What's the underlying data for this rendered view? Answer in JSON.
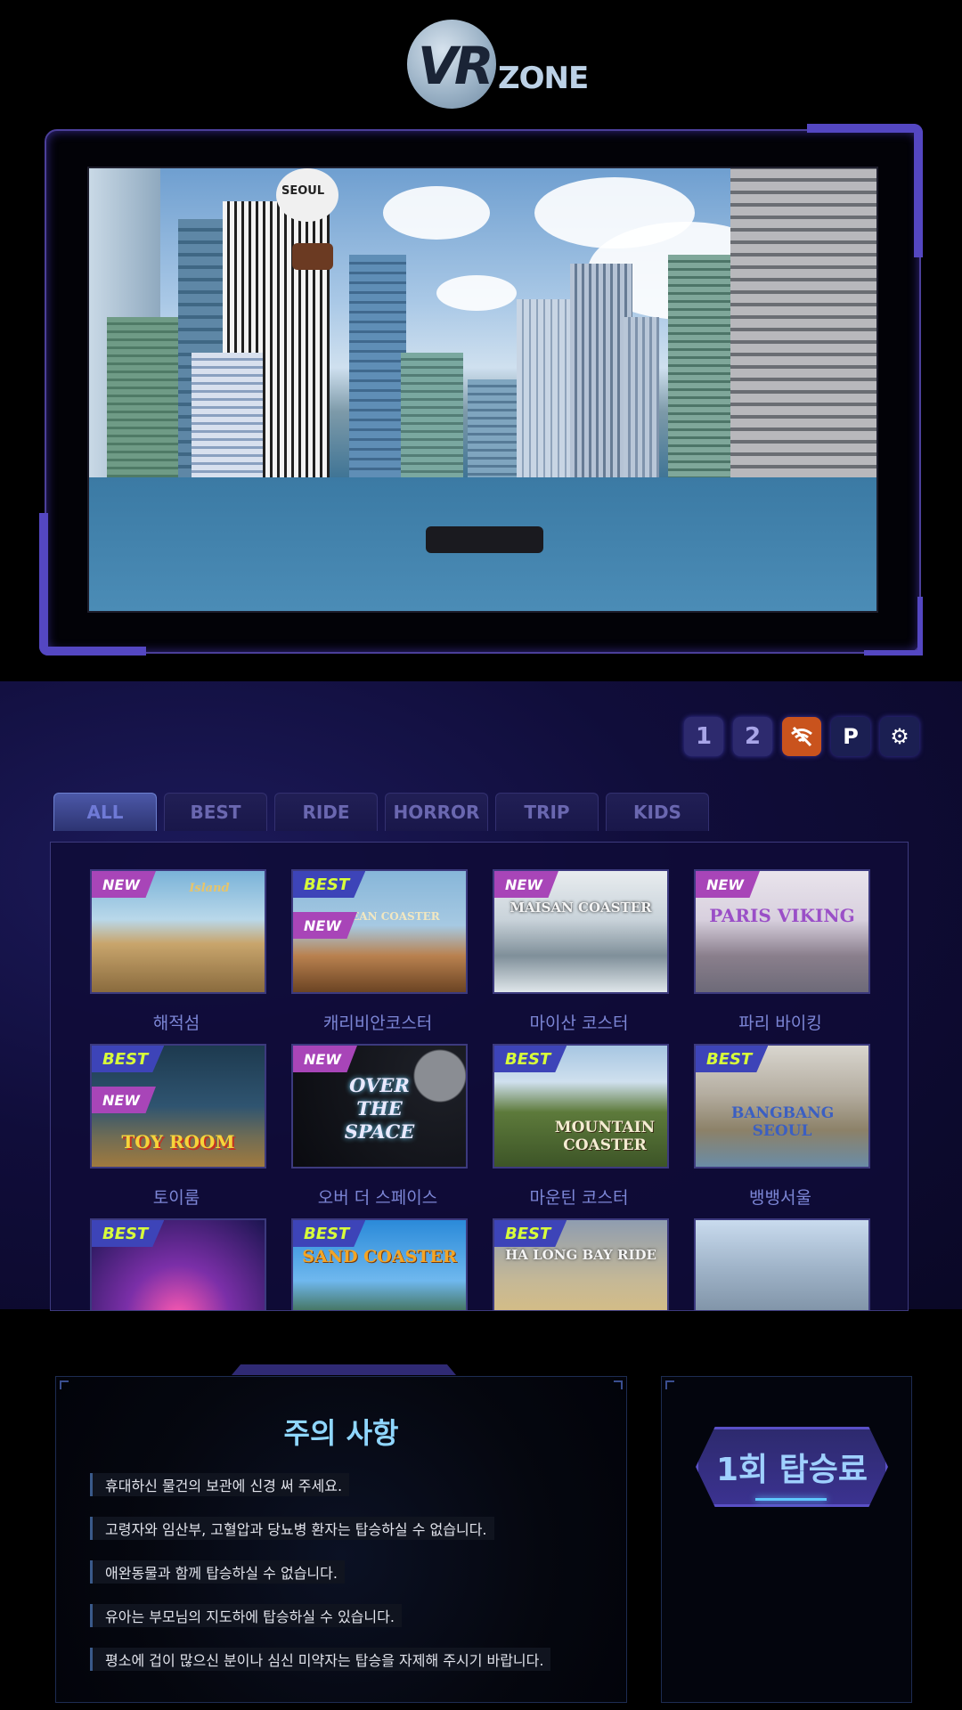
{
  "logo": {
    "vr": "VR",
    "zone": "ZONE"
  },
  "scene": {
    "balloon_text": "SEOUL"
  },
  "toolbar": {
    "btn1": "1",
    "btn2": "2",
    "btn_wifi": "wifi-off",
    "btn_p": "P",
    "btn_gear": "⚙"
  },
  "tabs": [
    {
      "label": "ALL",
      "active": true
    },
    {
      "label": "BEST",
      "active": false
    },
    {
      "label": "RIDE",
      "active": false
    },
    {
      "label": "HORROR",
      "active": false
    },
    {
      "label": "TRIP",
      "active": false
    },
    {
      "label": "KIDS",
      "active": false
    }
  ],
  "cards": [
    {
      "label": "해적섬",
      "badges": [
        "NEW"
      ],
      "thumb_title": "Island"
    },
    {
      "label": "캐리비안코스터",
      "badges": [
        "BEST",
        "NEW"
      ],
      "thumb_title": "RIBBEAN COASTER"
    },
    {
      "label": "마이산 코스터",
      "badges": [
        "NEW"
      ],
      "thumb_title": "MAISAN COASTER"
    },
    {
      "label": "파리 바이킹",
      "badges": [
        "NEW"
      ],
      "thumb_title": "PARIS VIKING"
    },
    {
      "label": "토이룸",
      "badges": [
        "BEST",
        "NEW"
      ],
      "thumb_title": "TOY ROOM"
    },
    {
      "label": "오버 더 스페이스",
      "badges": [
        "NEW"
      ],
      "thumb_title": "OVER THE SPACE"
    },
    {
      "label": "마운틴 코스터",
      "badges": [
        "BEST"
      ],
      "thumb_title": "MOUNTAIN COASTER"
    },
    {
      "label": "뱅뱅서울",
      "badges": [
        "BEST"
      ],
      "thumb_title": "BANGBANG SEOUL"
    },
    {
      "label": "",
      "badges": [
        "BEST"
      ],
      "thumb_title": ""
    },
    {
      "label": "",
      "badges": [
        "BEST"
      ],
      "thumb_title": "SAND COASTER"
    },
    {
      "label": "",
      "badges": [
        "BEST"
      ],
      "thumb_title": "HA LONG BAY RIDE"
    },
    {
      "label": "",
      "badges": [],
      "thumb_title": ""
    }
  ],
  "notice": {
    "title": "주의 사항",
    "items": [
      "휴대하신 물건의 보관에 신경 써 주세요.",
      "고령자와 임산부, 고혈압과 당뇨병 환자는 탑승하실 수 없습니다.",
      "애완동물과 함께 탑승하실 수 없습니다.",
      "유아는 부모님의 지도하에 탑승하실 수 있습니다.",
      "평소에 겁이 많으신 분이나 심신 미약자는 탑승을 자제해 주시기 바랍니다."
    ]
  },
  "price": {
    "label": "1회 탑승료"
  },
  "colors": {
    "accent": "#5447c2",
    "best_badge": "#3d44b8",
    "new_badge": "#a845b8",
    "best_text": "#d8ff3a"
  }
}
